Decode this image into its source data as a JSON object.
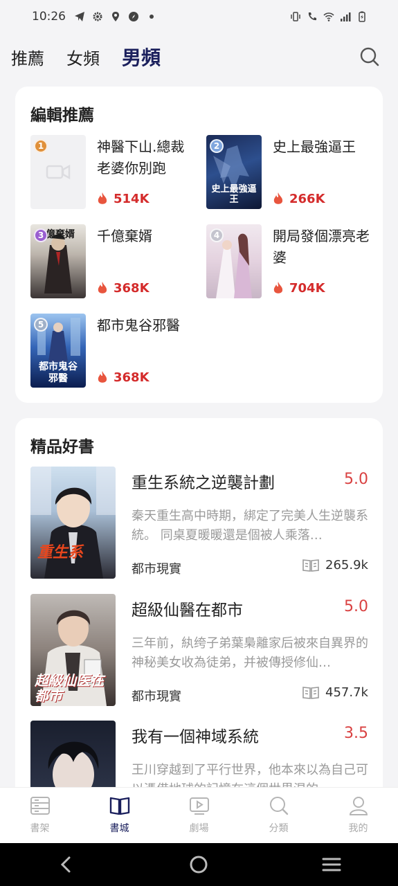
{
  "status": {
    "time": "10:26"
  },
  "tabs": [
    {
      "label": "推薦"
    },
    {
      "label": "女頻"
    },
    {
      "label": "男頻"
    }
  ],
  "editor_recommend": {
    "title": "編輯推薦",
    "items": [
      {
        "rank": "1",
        "name": "神醫下山.總裁老婆你別跑",
        "heat": "514K"
      },
      {
        "rank": "2",
        "name": "史上最強逼王",
        "heat": "266K",
        "cover_text": "史上最強逼王"
      },
      {
        "rank": "3",
        "name": "千億棄婿",
        "heat": "368K",
        "cover_text": "億棄婿"
      },
      {
        "rank": "4",
        "name": "開局發個漂亮老婆",
        "heat": "704K"
      },
      {
        "rank": "5",
        "name": "都市鬼谷邪醫",
        "heat": "368K",
        "cover_text": "都市鬼谷邪醫"
      }
    ]
  },
  "premium": {
    "title": "精品好書",
    "books": [
      {
        "title": "重生系統之逆襲計劃",
        "score": "5.0",
        "desc": "秦天重生高中時期，綁定了完美人生逆襲系統。 同桌夏暖暖還是個被人乘落…",
        "category": "都市現實",
        "reads": "265.9k",
        "cover_text": "重生系"
      },
      {
        "title": "超級仙醫在都市",
        "score": "5.0",
        "desc": "三年前，紈绔子弟葉梟離家后被來自異界的神秘美女收為徒弟，并被傳授修仙…",
        "category": "都市現實",
        "reads": "457.7k",
        "cover_text": "超級仙医在都市"
      },
      {
        "title": "我有一個神域系統",
        "score": "3.5",
        "desc": "王川穿越到了平行世界，他本來以為自己可以憑借地球的記憶在這個世界混的…"
      }
    ]
  },
  "bottom_nav": [
    {
      "label": "書架"
    },
    {
      "label": "書城"
    },
    {
      "label": "劇場"
    },
    {
      "label": "分類"
    },
    {
      "label": "我的"
    }
  ],
  "colors": {
    "accent": "#1a1f5c",
    "heat": "#d42b2b",
    "score": "#d94141",
    "background": "#f4f4f6"
  }
}
